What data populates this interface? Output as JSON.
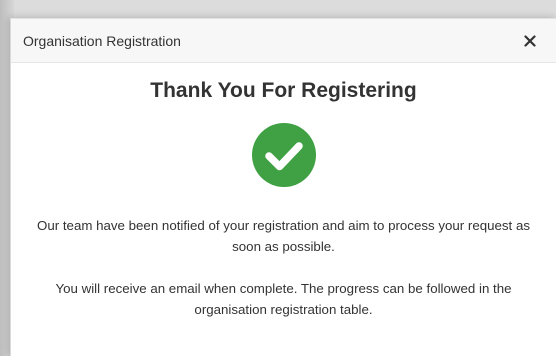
{
  "modal": {
    "title": "Organisation Registration",
    "close_label": "×",
    "heading": "Thank You For Registering",
    "success_icon": "check-circle-icon",
    "message_line_1": "Our team have been notified of your registration and aim to process your request as soon as possible.",
    "message_line_2": "You will receive an email when complete. The progress can be followed in the organisation registration table."
  },
  "colors": {
    "success_green": "#3fa044",
    "check_white": "#ffffff",
    "text": "#333333",
    "header_bg": "#f7f7f7"
  }
}
